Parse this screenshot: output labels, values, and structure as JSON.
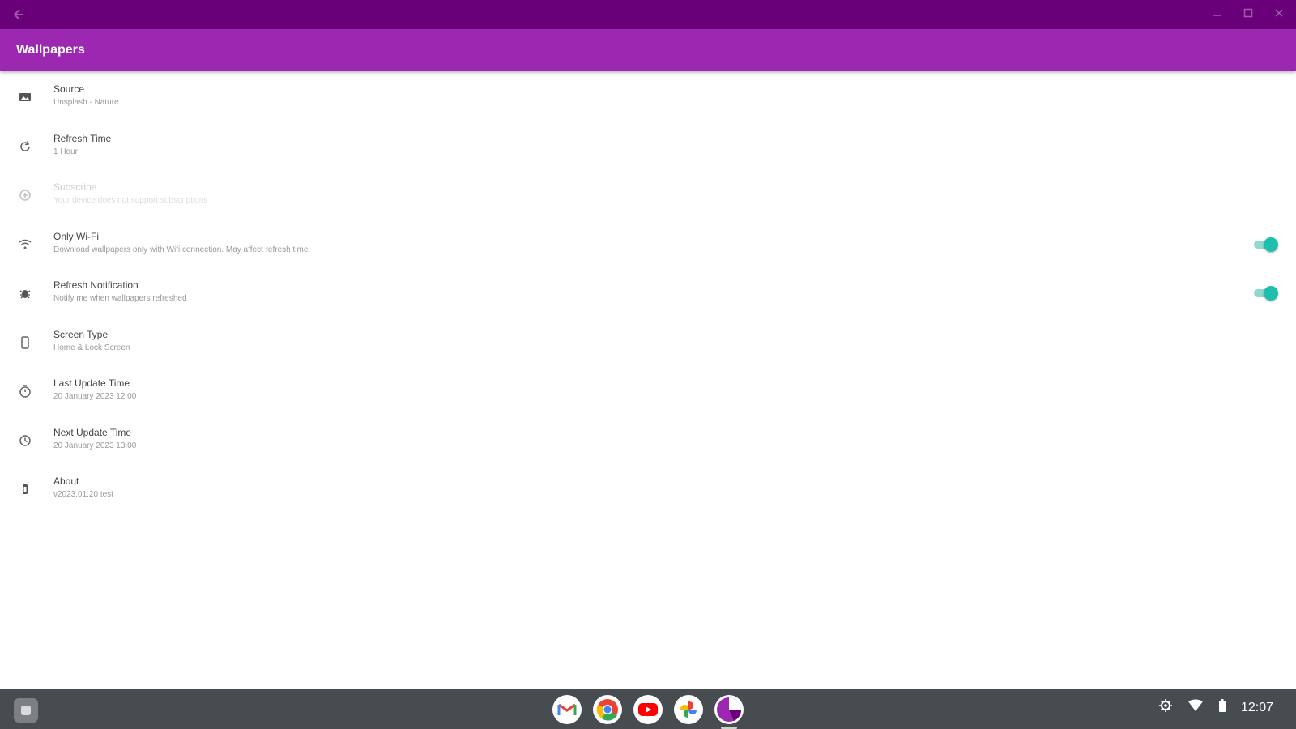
{
  "window": {
    "back_icon": "arrow-left-icon",
    "controls": [
      "minimize-icon",
      "maximize-icon",
      "close-icon"
    ]
  },
  "appbar": {
    "title": "Wallpapers"
  },
  "settings": [
    {
      "title": "Source",
      "subtitle": "Unsplash - Nature",
      "icon": "image-icon",
      "enabled": true
    },
    {
      "title": "Refresh Time",
      "subtitle": "1 Hour",
      "icon": "refresh-icon",
      "enabled": true
    },
    {
      "title": "Subscribe",
      "subtitle": "Your device does not support subscriptions",
      "icon": "subscribe-icon",
      "enabled": false
    },
    {
      "title": "Only Wi-Fi",
      "subtitle": "Download wallpapers only with Wifi connection. May affect refresh time.",
      "icon": "wifi-icon",
      "enabled": true,
      "toggle": true
    },
    {
      "title": "Refresh Notification",
      "subtitle": "Notify me when wallpapers refreshed",
      "icon": "bug-icon",
      "enabled": true,
      "toggle": true
    },
    {
      "title": "Screen Type",
      "subtitle": "Home & Lock Screen",
      "icon": "phone-icon",
      "enabled": true
    },
    {
      "title": "Last Update Time",
      "subtitle": "20 January 2023 12:00",
      "icon": "timer-icon",
      "enabled": true
    },
    {
      "title": "Next Update Time",
      "subtitle": "20 January 2023 13:00",
      "icon": "clock-icon",
      "enabled": true
    },
    {
      "title": "About",
      "subtitle": "v2023.01.20 test",
      "icon": "info-icon",
      "enabled": true
    }
  ],
  "toggles": {
    "only_wifi": true,
    "refresh_notification": true
  },
  "colors": {
    "titlebar": "#6a0079",
    "appbar": "#9c27b0",
    "accent": "#1fbfae",
    "shelf": "#474c50"
  },
  "shelf": {
    "apps": [
      "gmail-icon",
      "chrome-icon",
      "youtube-icon",
      "photos-icon",
      "wallpapers-app-icon"
    ],
    "tray_icons": [
      "settings-icon",
      "wifi-signal-icon",
      "battery-icon"
    ],
    "clock": "12:07"
  }
}
